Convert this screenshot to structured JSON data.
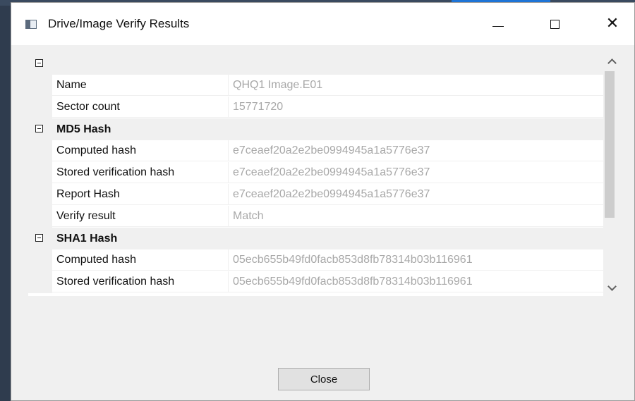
{
  "window": {
    "title": "Drive/Image Verify Results",
    "icon": "window-app-icon",
    "controls": {
      "minimize": "—",
      "maximize": "☐",
      "close": "✕"
    }
  },
  "grid": {
    "top_category": {
      "label": ""
    },
    "top_items": [
      {
        "name": "Name",
        "value": "QHQ1 Image.E01"
      },
      {
        "name": "Sector count",
        "value": "15771720"
      }
    ],
    "md5": {
      "label": "MD5 Hash",
      "items": [
        {
          "name": "Computed hash",
          "value": "e7ceaef20a2e2be0994945a1a5776e37"
        },
        {
          "name": "Stored verification hash",
          "value": "e7ceaef20a2e2be0994945a1a5776e37"
        },
        {
          "name": "Report Hash",
          "value": "e7ceaef20a2e2be0994945a1a5776e37"
        },
        {
          "name": "Verify result",
          "value": "Match"
        }
      ]
    },
    "sha1": {
      "label": "SHA1 Hash",
      "items": [
        {
          "name": "Computed hash",
          "value": "05ecb655b49fd0facb853d8fb78314b03b116961"
        },
        {
          "name": "Stored verification hash",
          "value": "05ecb655b49fd0facb853d8fb78314b03b116961"
        }
      ]
    }
  },
  "footer": {
    "close_label": "Close"
  }
}
